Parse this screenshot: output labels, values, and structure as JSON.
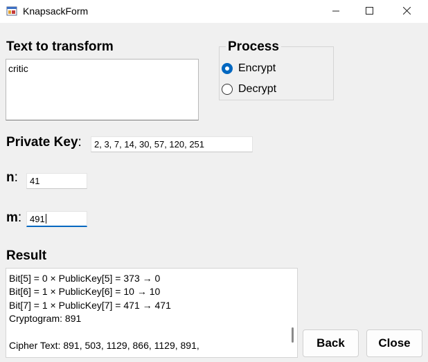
{
  "window": {
    "title": "KnapsackForm",
    "icons": {
      "app": "app-form-icon",
      "minimize": "minimize-icon",
      "maximize": "maximize-icon",
      "close": "close-icon"
    }
  },
  "text_to_transform": {
    "label": "Text to transform",
    "value": "critic"
  },
  "process": {
    "legend": "Process",
    "options": [
      {
        "label": "Encrypt",
        "checked": true
      },
      {
        "label": "Decrypt",
        "checked": false
      }
    ]
  },
  "private_key": {
    "label": "Private Key",
    "colon": ":",
    "value": "2, 3, 7, 14, 30, 57, 120, 251"
  },
  "n": {
    "label": "n",
    "colon": ":",
    "value": "41"
  },
  "m": {
    "label": "m",
    "colon": ":",
    "value": "491"
  },
  "result": {
    "label": "Result",
    "lines": [
      "Bit[5] = 0 × PublicKey[5] = 373 → 0",
      "Bit[6] = 1 × PublicKey[6] = 10 → 10",
      "Bit[7] = 1 × PublicKey[7] = 471 → 471",
      "Cryptogram: 891",
      "",
      "Cipher Text: 891, 503, 1129, 866, 1129, 891,"
    ]
  },
  "buttons": {
    "back": "Back",
    "close": "Close"
  },
  "colors": {
    "accent": "#0067c0",
    "background": "#f0f0f0"
  }
}
